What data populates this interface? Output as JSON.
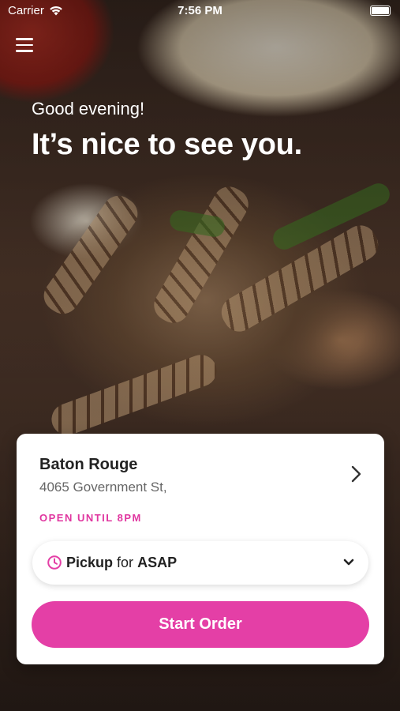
{
  "status_bar": {
    "carrier": "Carrier",
    "time": "7:56 PM"
  },
  "hero": {
    "greeting": "Good evening!",
    "headline": "It’s nice to see you."
  },
  "store": {
    "name": "Baton Rouge",
    "address": "4065 Government St,",
    "hours": "OPEN UNTIL 8PM"
  },
  "pickup": {
    "mode": "Pickup",
    "connector": "for",
    "time": "ASAP"
  },
  "actions": {
    "start_order": "Start Order"
  },
  "colors": {
    "accent": "#e43fa6",
    "status_text": "#e0359f"
  },
  "icons": [
    "wifi-icon",
    "battery-icon",
    "menu-icon",
    "chevron-right-icon",
    "clock-icon",
    "chevron-down-icon"
  ]
}
